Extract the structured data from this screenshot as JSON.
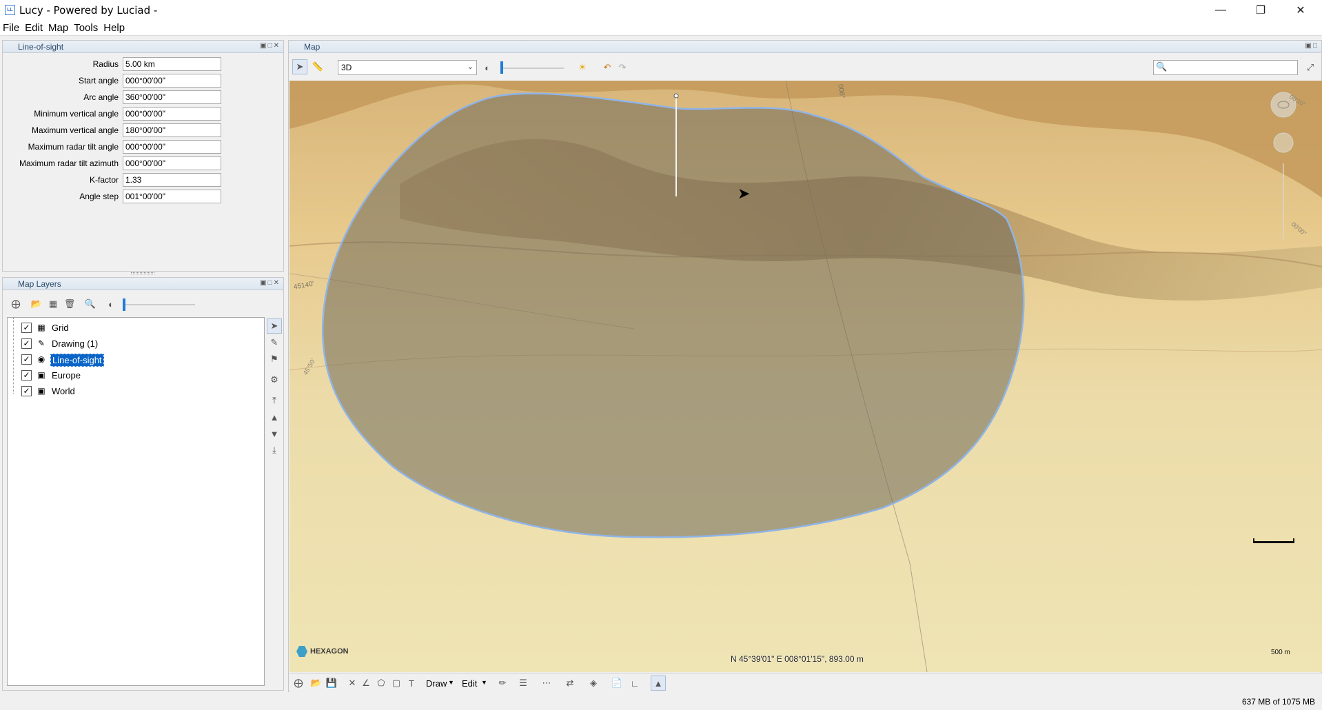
{
  "window": {
    "title": "Lucy - Powered by Luciad -",
    "icon_text": "LL"
  },
  "menu": [
    "File",
    "Edit",
    "Map",
    "Tools",
    "Help"
  ],
  "line_of_sight_panel": {
    "title": "Line-of-sight",
    "fields": [
      {
        "label": "Radius",
        "value": "5.00 km"
      },
      {
        "label": "Start angle",
        "value": "000°00'00\""
      },
      {
        "label": "Arc angle",
        "value": "360°00'00\""
      },
      {
        "label": "Minimum vertical angle",
        "value": "000°00'00\""
      },
      {
        "label": "Maximum vertical angle",
        "value": "180°00'00\""
      },
      {
        "label": "Maximum radar tilt angle",
        "value": "000°00'00\""
      },
      {
        "label": "Maximum radar tilt azimuth",
        "value": "000°00'00\""
      },
      {
        "label": "K-factor",
        "value": "1.33"
      },
      {
        "label": "Angle step",
        "value": "001°00'00\""
      }
    ]
  },
  "map_layers_panel": {
    "title": "Map Layers",
    "layers": [
      {
        "label": "Grid",
        "checked": true,
        "icon": "grid-icon",
        "selected": false
      },
      {
        "label": "Drawing (1)",
        "checked": true,
        "icon": "drawing-icon",
        "selected": false
      },
      {
        "label": "Line-of-sight",
        "checked": true,
        "icon": "eye-icon",
        "selected": true
      },
      {
        "label": "Europe",
        "checked": true,
        "icon": "raster-icon",
        "selected": false
      },
      {
        "label": "World",
        "checked": true,
        "icon": "raster-icon",
        "selected": false
      }
    ]
  },
  "map_panel": {
    "title": "Map",
    "view_mode": "3D",
    "search_placeholder": "",
    "coordinates": "N 45°39'01\" E 008°01'15\", 893.00 m",
    "scale_label": "500 m",
    "logo_text": "HEXAGON",
    "grid_labels": [
      "45140'",
      "008°",
      "00'10\"",
      "00'00\"",
      "45°50'"
    ],
    "bottom_toolbar": {
      "draw_label": "Draw",
      "edit_label": "Edit"
    }
  },
  "status": {
    "memory": "637 MB of 1075 MB"
  },
  "colors": {
    "accent": "#0a64c8",
    "terrain_light": "#ecdfaa",
    "terrain_dark": "#8a6a3e",
    "coverage_outline": "#8fb4e8"
  }
}
